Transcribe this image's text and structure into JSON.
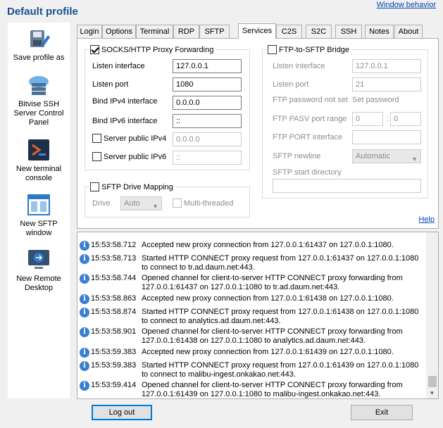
{
  "header": {
    "title": "Default profile",
    "window_behavior": "Window behavior"
  },
  "sidebar": [
    {
      "label": "Save profile as",
      "icon": "save-profile-icon"
    },
    {
      "label": "Bitvise SSH Server Control Panel",
      "icon": "server-control-icon"
    },
    {
      "label": "New terminal console",
      "icon": "terminal-icon"
    },
    {
      "label": "New SFTP window",
      "icon": "sftp-icon"
    },
    {
      "label": "New Remote Desktop",
      "icon": "remote-desktop-icon"
    }
  ],
  "tabs": [
    "Login",
    "Options",
    "Terminal",
    "RDP",
    "SFTP",
    "Services",
    "C2S",
    "S2C",
    "SSH",
    "Notes",
    "About"
  ],
  "active_tab": "Services",
  "socks": {
    "title": "SOCKS/HTTP Proxy Forwarding",
    "checked": true,
    "listen_interface_label": "Listen interface",
    "listen_interface": "127.0.0.1",
    "listen_port_label": "Listen port",
    "listen_port": "1080",
    "bind_ipv4_label": "Bind IPv4 interface",
    "bind_ipv4": "0.0.0.0",
    "bind_ipv6_label": "Bind IPv6 interface",
    "bind_ipv6": "::",
    "server_ipv4_label": "Server public IPv4",
    "server_ipv4": "0.0.0.0",
    "server_ipv6_label": "Server public IPv6",
    "server_ipv6": "::"
  },
  "sftp_drive": {
    "title": "SFTP Drive Mapping",
    "drive_label": "Drive",
    "drive_value": "Auto",
    "multithreaded_label": "Multi-threaded"
  },
  "ftp_bridge": {
    "title": "FTP-to-SFTP Bridge",
    "listen_interface_label": "Listen interface",
    "listen_interface": "127.0.0.1",
    "listen_port_label": "Listen port",
    "listen_port": "21",
    "password_label": "FTP password not set",
    "set_password": "Set password",
    "pasv_label": "FTP PASV port range",
    "pasv_from": "0",
    "pasv_sep": ":",
    "pasv_to": "0",
    "port_interface_label": "FTP PORT interface",
    "newline_label": "SFTP newline",
    "newline_value": "Automatic",
    "start_dir_label": "SFTP start directory"
  },
  "help_label": "Help",
  "log": [
    {
      "ts": "15:53:58.712",
      "lines": [
        "Accepted new proxy connection from 127.0.0.1:61437 on 127.0.0.1:1080."
      ]
    },
    {
      "ts": "15:53:58.713",
      "lines": [
        "Started HTTP CONNECT proxy request from 127.0.0.1:61437 on 127.0.0.1:1080",
        "to connect to tr.ad.daum.net:443."
      ]
    },
    {
      "ts": "15:53:58.744",
      "lines": [
        "Opened channel for client-to-server HTTP CONNECT proxy forwarding from",
        "127.0.0.1:61437 on 127.0.0.1:1080 to tr.ad.daum.net:443."
      ]
    },
    {
      "ts": "15:53:58.863",
      "lines": [
        "Accepted new proxy connection from 127.0.0.1:61438 on 127.0.0.1:1080."
      ]
    },
    {
      "ts": "15:53:58.874",
      "lines": [
        "Started HTTP CONNECT proxy request from 127.0.0.1:61438 on 127.0.0.1:1080",
        "to connect to analytics.ad.daum.net:443."
      ]
    },
    {
      "ts": "15:53:58.901",
      "lines": [
        "Opened channel for client-to-server HTTP CONNECT proxy forwarding from",
        "127.0.0.1:61438 on 127.0.0.1:1080 to analytics.ad.daum.net:443."
      ]
    },
    {
      "ts": "15:53:59.383",
      "lines": [
        "Accepted new proxy connection from 127.0.0.1:61439 on 127.0.0.1:1080."
      ]
    },
    {
      "ts": "15:53:59.383",
      "lines": [
        "Started HTTP CONNECT proxy request from 127.0.0.1:61439 on 127.0.0.1:1080",
        "to connect to malibu-ingest.onkakao.net:443."
      ]
    },
    {
      "ts": "15:53:59.414",
      "lines": [
        "Opened channel for client-to-server HTTP CONNECT proxy forwarding from",
        "127.0.0.1:61439 on 127.0.0.1:1080 to malibu-ingest.onkakao.net:443."
      ]
    }
  ],
  "buttons": {
    "logout": "Log out",
    "exit": "Exit"
  }
}
